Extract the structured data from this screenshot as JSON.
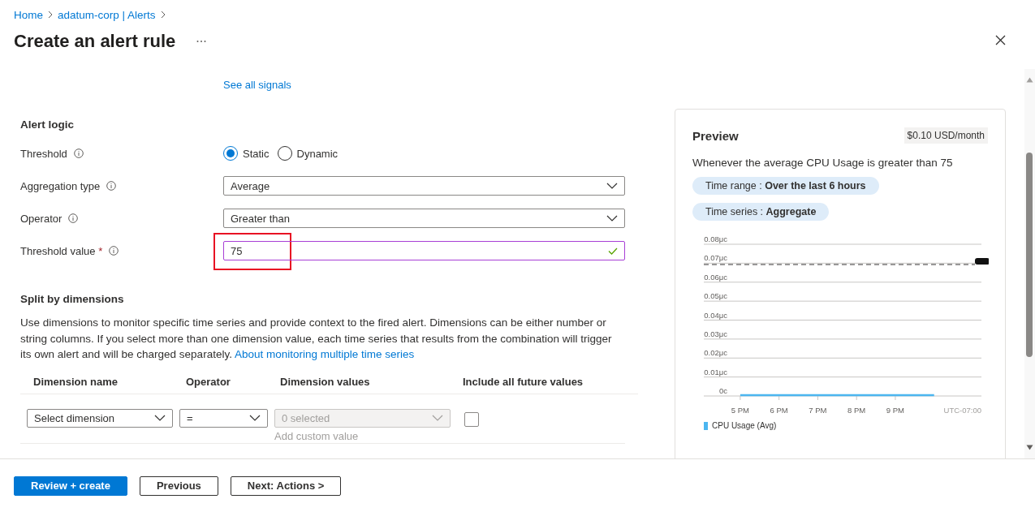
{
  "breadcrumb": [
    "Home",
    "adatum-corp | Alerts"
  ],
  "title": "Create an alert rule",
  "signals_link": "See all signals",
  "alert_logic": {
    "heading": "Alert logic",
    "threshold": {
      "label": "Threshold",
      "options": [
        {
          "label": "Static",
          "selected": true
        },
        {
          "label": "Dynamic",
          "selected": false
        }
      ]
    },
    "fields": [
      {
        "kind": "dropdown",
        "label": "Aggregation type",
        "value": "Average"
      },
      {
        "kind": "dropdown",
        "label": "Operator",
        "value": "Greater than"
      },
      {
        "kind": "text",
        "label": "Threshold value",
        "required_mark": "*",
        "value": "75",
        "valid": true,
        "highlighted": true
      }
    ]
  },
  "split": {
    "heading": "Split by dimensions",
    "description": "Use dimensions to monitor specific time series and provide context to the fired alert. Dimensions can be either number or string columns. If you select more than one dimension value, each time series that results from the combination will trigger its own alert and will be charged separately.",
    "link": "About monitoring multiple time series",
    "columns": [
      "Dimension name",
      "Operator",
      "Dimension values",
      "Include all future values"
    ],
    "rows": [
      {
        "dimension_name": {
          "placeholder": "Select dimension"
        },
        "operator": "=",
        "values": {
          "placeholder": "0 selected",
          "disabled": true
        },
        "add_custom": "Add custom value",
        "include_future": false
      }
    ]
  },
  "preview": {
    "title": "Preview",
    "price": "$0.10 USD/month",
    "summary": "Whenever the average CPU Usage is greater than 75",
    "chips": [
      {
        "label": "Time range :",
        "value": "Over the last 6 hours"
      },
      {
        "label": "Time series :",
        "value": "Aggregate"
      }
    ],
    "timezone": "UTC-07:00",
    "chart_data": {
      "type": "line",
      "categories": [
        null,
        "5 PM",
        "6 PM",
        "7 PM",
        "8 PM",
        "9 PM",
        null,
        null
      ],
      "ylim": [
        0,
        0.08
      ],
      "yticks": [
        {
          "value": 0,
          "label": "0c"
        },
        {
          "value": 0.01,
          "label": "0.01μc"
        },
        {
          "value": 0.02,
          "label": "0.02μc"
        },
        {
          "value": 0.03,
          "label": "0.03μc"
        },
        {
          "value": 0.04,
          "label": "0.04μc"
        },
        {
          "value": 0.05,
          "label": "0.05μc"
        },
        {
          "value": 0.06,
          "label": "0.06μc"
        },
        {
          "value": 0.07,
          "label": "0.07μc"
        },
        {
          "value": 0.08,
          "label": "0.08μc"
        }
      ],
      "series": [
        {
          "name": "CPU Usage (Avg)",
          "color": "#4cb6f0",
          "values": [
            null,
            0,
            0,
            0,
            0,
            0,
            0,
            null
          ]
        }
      ],
      "grid": true
    }
  },
  "buttons": [
    {
      "label": "Review + create",
      "primary": true
    },
    {
      "label": "Previous",
      "primary": false
    },
    {
      "label": "Next: Actions >",
      "primary": false
    }
  ]
}
